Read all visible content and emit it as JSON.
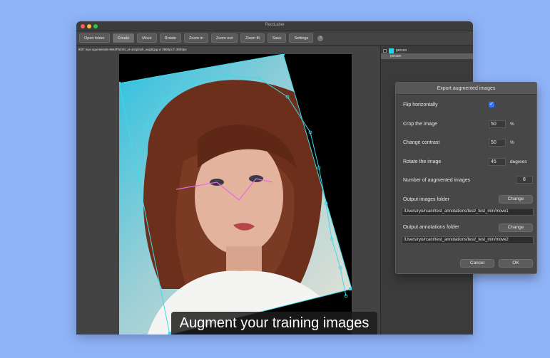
{
  "window": {
    "title": "RectLabel"
  },
  "toolbar": {
    "buttons": [
      "Open folder",
      "Create",
      "Move",
      "Rotate",
      "Zoom in",
      "Zoom out",
      "Zoom fit",
      "Save",
      "Settings"
    ],
    "help": "?"
  },
  "image_info": {
    "path": "8/27 ayo-ogunseinde-6W4F62sN_yI-unsplash_aug8.jpg w 3960px h 3653px"
  },
  "labels": [
    {
      "name": "person",
      "color": "#21d4e6"
    },
    {
      "name": "person"
    }
  ],
  "dialog": {
    "title": "Export augmented images",
    "flip_label": "Flip horizontally",
    "flip_checked": true,
    "check_mark": "✓",
    "crop_label": "Crop the image",
    "crop_value": "50",
    "crop_unit": "%",
    "contrast_label": "Change contrast",
    "contrast_value": "50",
    "contrast_unit": "%",
    "rotate_label": "Rotate the image",
    "rotate_value": "45",
    "rotate_unit": "degrees",
    "count_label": "Number of augmented images",
    "count_value": "8",
    "images_folder_label": "Output images folder",
    "change_label": "Change",
    "images_folder_path": "/Users/ryo/rcam/test_annotations/test/_test_min/move1",
    "annotations_folder_label": "Output annotations folder",
    "annotations_folder_path": "/Users/ryo/rcam/test_annotations/test/_test_min/move2",
    "cancel_label": "Cancel",
    "ok_label": "OK"
  },
  "caption": "Augment your training images"
}
